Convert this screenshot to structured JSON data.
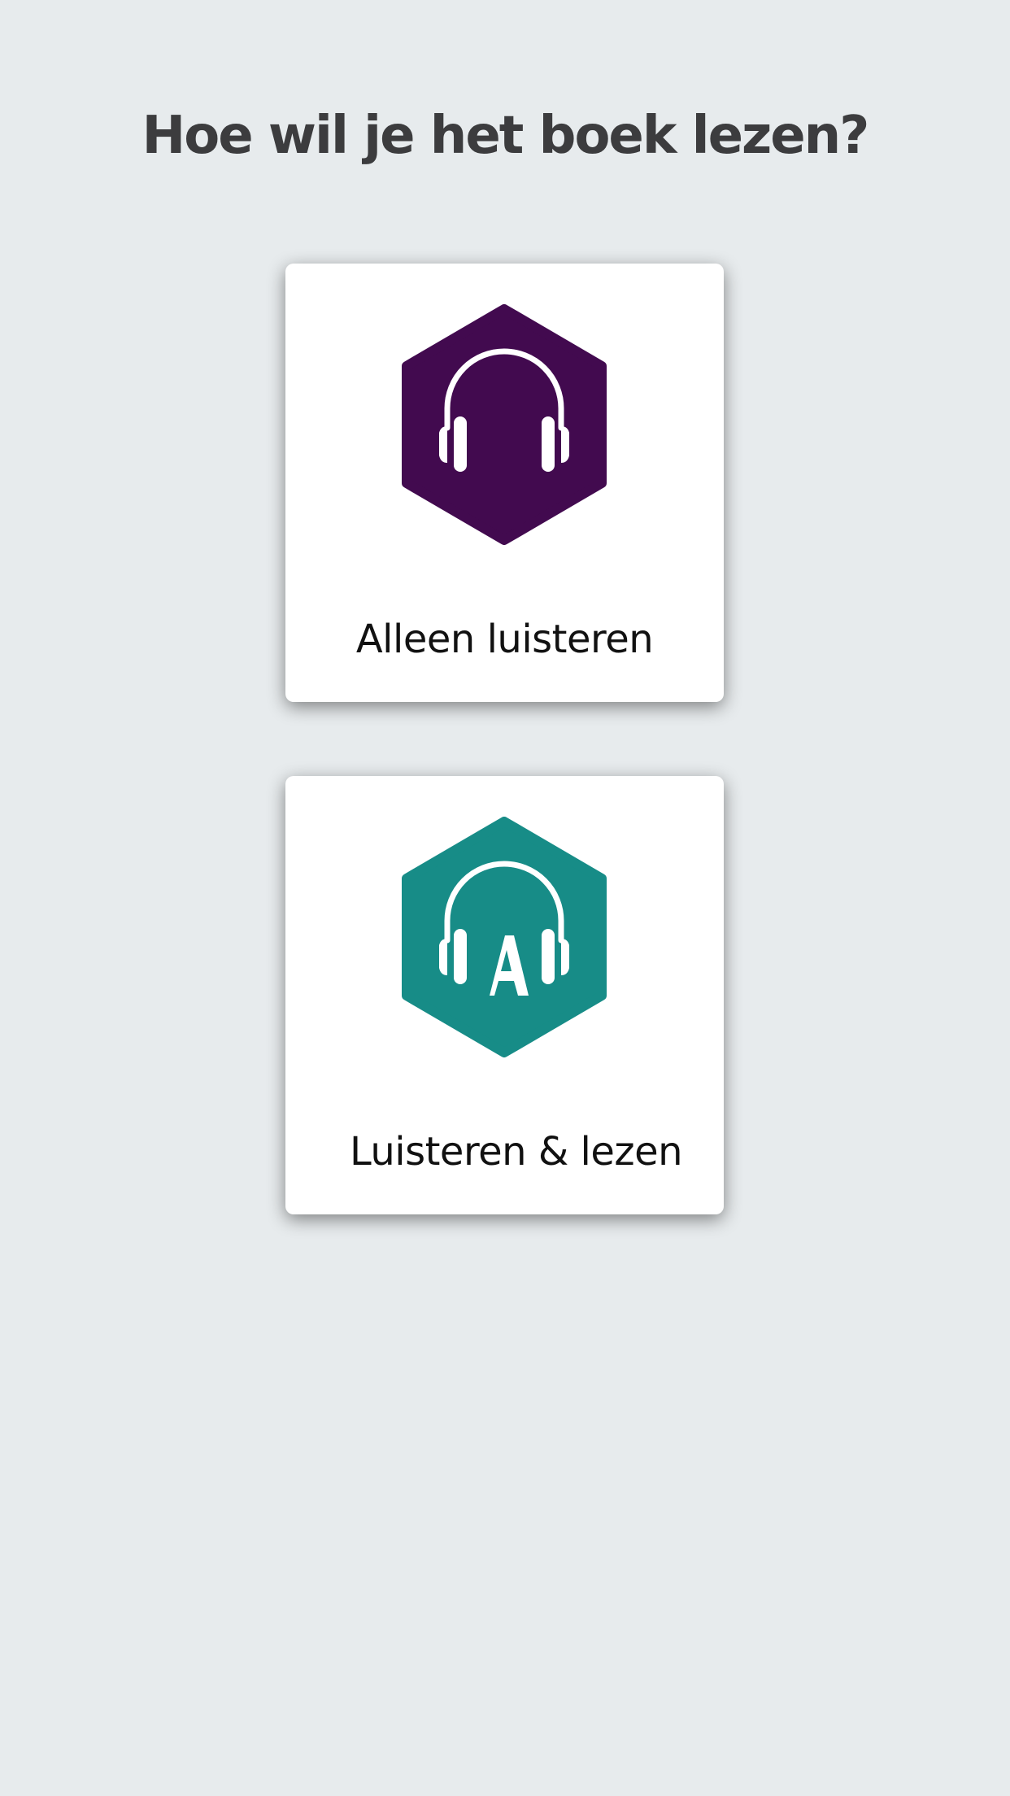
{
  "page": {
    "title": "Hoe wil je het boek lezen?"
  },
  "options": [
    {
      "label": "Alleen luisteren",
      "icon": "headphones-icon",
      "color": "#420a4f"
    },
    {
      "label": "Luisteren & lezen",
      "icon": "headphones-letter-a-icon",
      "color": "#178c87"
    }
  ],
  "colors": {
    "background": "#e7ebed",
    "card": "#ffffff",
    "title": "#3c3c3e"
  }
}
